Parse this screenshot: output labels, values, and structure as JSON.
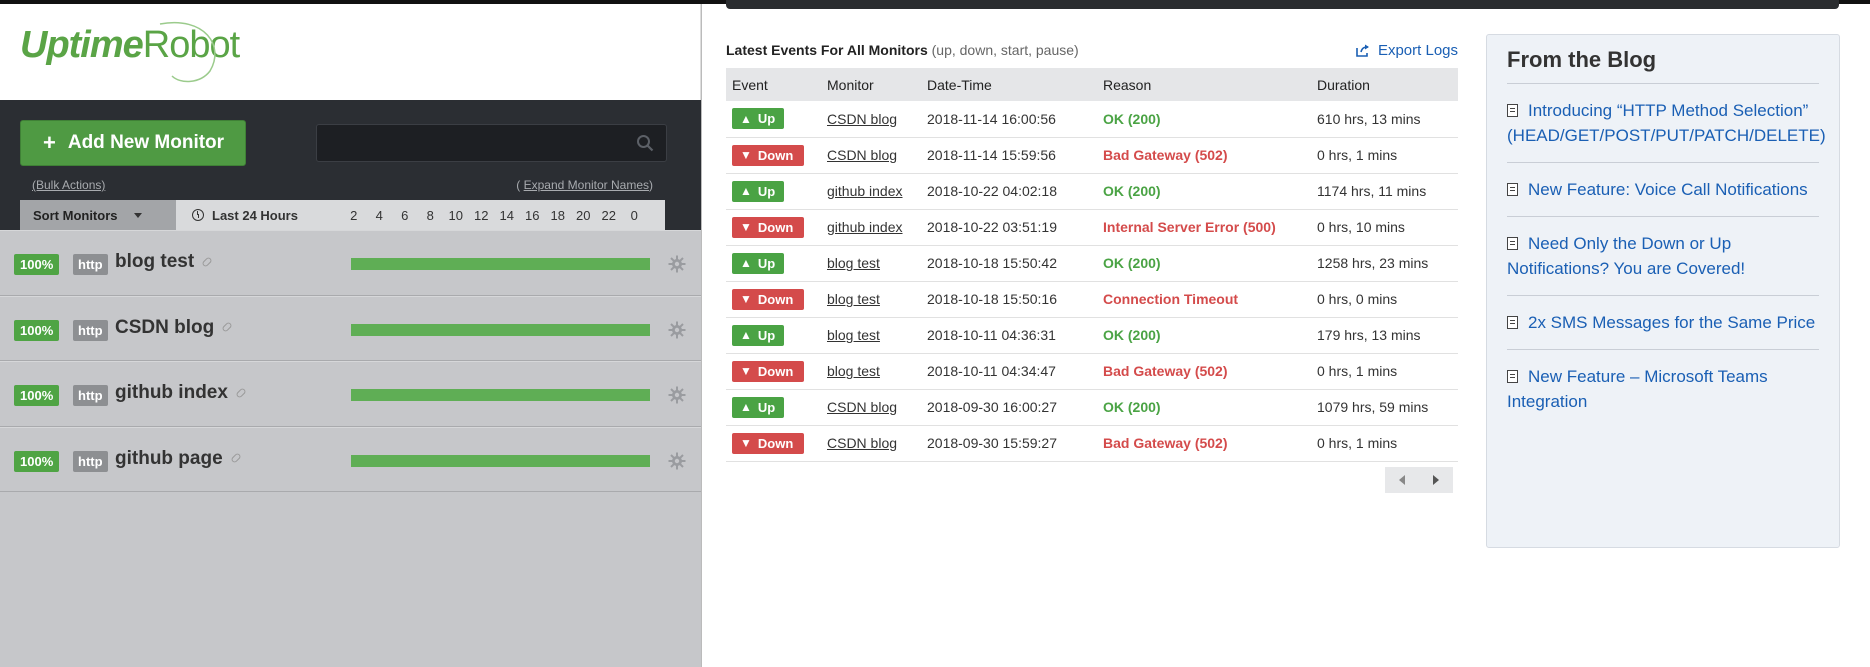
{
  "logo": {
    "part1": "Uptime",
    "part2": "Robot"
  },
  "toolbar": {
    "add_label": "Add New Monitor",
    "search_placeholder": "",
    "bulk_actions": "(Bulk Actions)",
    "expand_prefix": "( ",
    "expand_link": "Expand Monitor Names",
    "expand_suffix": ")",
    "sort_label": "Sort Monitors",
    "range_label": "Last 24 Hours",
    "hours": [
      "2",
      "4",
      "6",
      "8",
      "10",
      "12",
      "14",
      "16",
      "18",
      "20",
      "22",
      "0"
    ]
  },
  "monitors": [
    {
      "uptime": "100%",
      "type": "http",
      "name": "blog test"
    },
    {
      "uptime": "100%",
      "type": "http",
      "name": "CSDN blog"
    },
    {
      "uptime": "100%",
      "type": "http",
      "name": "github index"
    },
    {
      "uptime": "100%",
      "type": "http",
      "name": "github page"
    }
  ],
  "events": {
    "title": "Latest Events For All Monitors",
    "subtitle": "(up, down, start, pause)",
    "export_label": "Export Logs",
    "columns": [
      "Event",
      "Monitor",
      "Date-Time",
      "Reason",
      "Duration"
    ],
    "rows": [
      {
        "event": "Up",
        "monitor": "CSDN blog",
        "datetime": "2018-11-14 16:00:56",
        "reason": "OK (200)",
        "duration": "610 hrs, 13 mins"
      },
      {
        "event": "Down",
        "monitor": "CSDN blog",
        "datetime": "2018-11-14 15:59:56",
        "reason": "Bad Gateway (502)",
        "duration": "0 hrs, 1 mins"
      },
      {
        "event": "Up",
        "monitor": "github index",
        "datetime": "2018-10-22 04:02:18",
        "reason": "OK (200)",
        "duration": "1174 hrs, 11 mins"
      },
      {
        "event": "Down",
        "monitor": "github index",
        "datetime": "2018-10-22 03:51:19",
        "reason": "Internal Server Error (500)",
        "duration": "0 hrs, 10 mins"
      },
      {
        "event": "Up",
        "monitor": "blog test",
        "datetime": "2018-10-18 15:50:42",
        "reason": "OK (200)",
        "duration": "1258 hrs, 23 mins"
      },
      {
        "event": "Down",
        "monitor": "blog test",
        "datetime": "2018-10-18 15:50:16",
        "reason": "Connection Timeout",
        "duration": "0 hrs, 0 mins"
      },
      {
        "event": "Up",
        "monitor": "blog test",
        "datetime": "2018-10-11 04:36:31",
        "reason": "OK (200)",
        "duration": "179 hrs, 13 mins"
      },
      {
        "event": "Down",
        "monitor": "blog test",
        "datetime": "2018-10-11 04:34:47",
        "reason": "Bad Gateway (502)",
        "duration": "0 hrs, 1 mins"
      },
      {
        "event": "Up",
        "monitor": "CSDN blog",
        "datetime": "2018-09-30 16:00:27",
        "reason": "OK (200)",
        "duration": "1079 hrs, 59 mins"
      },
      {
        "event": "Down",
        "monitor": "CSDN blog",
        "datetime": "2018-09-30 15:59:27",
        "reason": "Bad Gateway (502)",
        "duration": "0 hrs, 1 mins"
      }
    ]
  },
  "blog": {
    "title": "From the Blog",
    "items": [
      "Introducing “HTTP Method Selection” (HEAD/GET/POST/PUT/PATCH/DELETE)",
      "New Feature: Voice Call Notifications",
      "Need Only the Down or Up Notifications? You are Covered!",
      "2x SMS Messages for the Same Price",
      "New Feature – Microsoft Teams Integration"
    ]
  },
  "colors": {
    "up": "#4aa344",
    "down": "#d44b4b",
    "link": "#1a5fb4",
    "brand": "#5aa446"
  }
}
